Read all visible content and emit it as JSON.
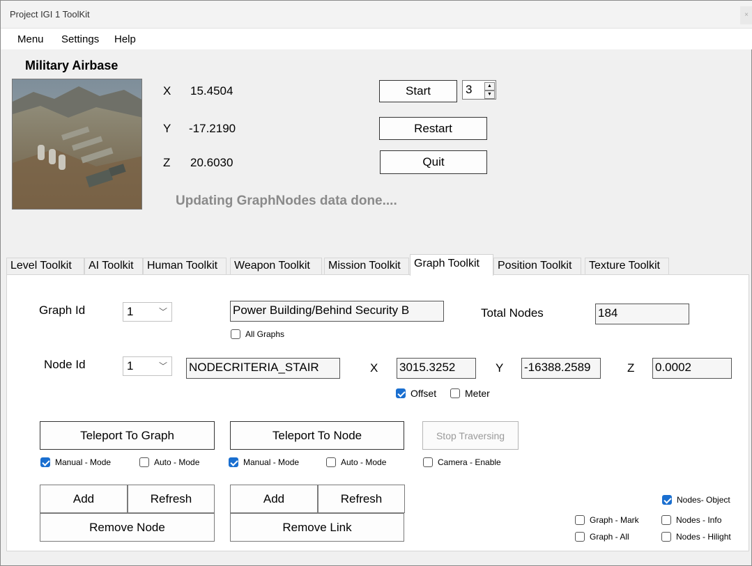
{
  "window": {
    "title": "Project IGI 1 ToolKit",
    "close_glyph": "×"
  },
  "menu": {
    "items": [
      "Menu",
      "Settings",
      "Help"
    ]
  },
  "level": {
    "name": "Military Airbase"
  },
  "coords": {
    "x_label": "X",
    "x_value": "15.4504",
    "y_label": "Y",
    "y_value": "-17.2190",
    "z_label": "Z",
    "z_value": "20.6030"
  },
  "controls": {
    "start": "Start",
    "restart": "Restart",
    "quit": "Quit",
    "level_number": "3",
    "spin_up": "▲",
    "spin_down": "▼"
  },
  "status": "Updating GraphNodes data done....",
  "tabs": [
    "Level Toolkit",
    "AI Toolkit",
    "Human Toolkit",
    "Weapon Toolkit",
    "Mission Toolkit",
    "Graph Toolkit",
    "Position Toolkit",
    "Texture Toolkit"
  ],
  "active_tab": "Graph Toolkit",
  "graph": {
    "graph_id_label": "Graph Id",
    "graph_id_value": "1",
    "graph_name": "Power Building/Behind Security B",
    "all_graphs_label": "All Graphs",
    "total_nodes_label": "Total Nodes",
    "total_nodes_value": "184",
    "node_id_label": "Node Id",
    "node_id_value": "1",
    "node_criteria": "NODECRITERIA_STAIR",
    "nx_label": "X",
    "nx_value": "3015.3252",
    "ny_label": "Y",
    "ny_value": "-16388.2589",
    "nz_label": "Z",
    "nz_value": "0.0002",
    "offset_label": "Offset",
    "meter_label": "Meter",
    "teleport_graph": "Teleport To Graph",
    "teleport_node": "Teleport To Node",
    "stop_traversing": "Stop Traversing",
    "manual_mode": "Manual - Mode",
    "auto_mode": "Auto - Mode",
    "camera_enable": "Camera - Enable",
    "add": "Add",
    "refresh": "Refresh",
    "remove_node": "Remove Node",
    "remove_link": "Remove Link",
    "nodes_object": "Nodes- Object",
    "graph_mark": "Graph - Mark",
    "nodes_info": "Nodes - Info",
    "graph_all": "Graph - All",
    "nodes_hilight": "Nodes - Hilight"
  },
  "checked": {
    "all_graphs": false,
    "offset": true,
    "meter": false,
    "graph_manual": true,
    "graph_auto": false,
    "node_manual": true,
    "node_auto": false,
    "camera_enable": false,
    "nodes_object": true,
    "graph_mark": false,
    "nodes_info": false,
    "graph_all": false,
    "nodes_hilight": false
  },
  "colors": {
    "accent": "#1a6fd0",
    "status_text": "#8a8a8a"
  }
}
